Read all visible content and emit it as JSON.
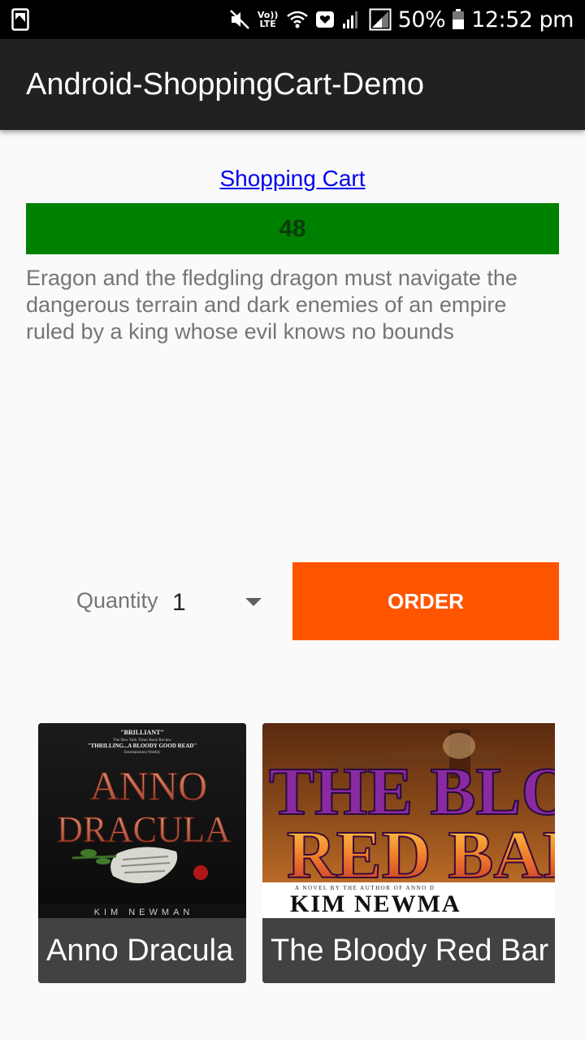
{
  "status_bar": {
    "volte_label": "Vo)) LTE",
    "battery_percent": "50%",
    "time": "12:52 pm",
    "icons": [
      "screenshot-icon",
      "mute-icon",
      "volte-icon",
      "wifi-icon",
      "message-icon",
      "signal-icon",
      "signal-icon-2",
      "battery-icon"
    ]
  },
  "app_bar": {
    "title": "Android-ShoppingCart-Demo"
  },
  "cart": {
    "link_label": "Shopping Cart",
    "count": "48"
  },
  "product": {
    "description": "Eragon and the fledgling dragon must navigate the dangerous terrain and dark enemies of an empire ruled by a king whose evil knows no bounds"
  },
  "order": {
    "quantity_label": "Quantity",
    "quantity_value": "1",
    "button_label": "ORDER"
  },
  "books": [
    {
      "title": "Anno Dracula",
      "cover": {
        "quote_top": "\"BRILLIANT\"",
        "quote_source_1": "The New York Times Book Review",
        "quote_line": "\"THRILLING...A BLOODY GOOD READ\"",
        "quote_source_2": "Entertainment Weekly",
        "title_line_1": "ANNO",
        "title_line_2": "DRACULA",
        "author": "KIM NEWMAN"
      }
    },
    {
      "title": "The Bloody Red Bar",
      "cover": {
        "title_line_1": "THE BLOOD",
        "title_line_2": "RED BARO",
        "tagline": "A NOVEL BY THE AUTHOR OF ANNO D",
        "author": "KIM NEWMA"
      }
    }
  ],
  "colors": {
    "app_bar": "#212121",
    "cart_count_background": "#008000",
    "order_button": "#ff5500",
    "link": "#0000ee"
  }
}
